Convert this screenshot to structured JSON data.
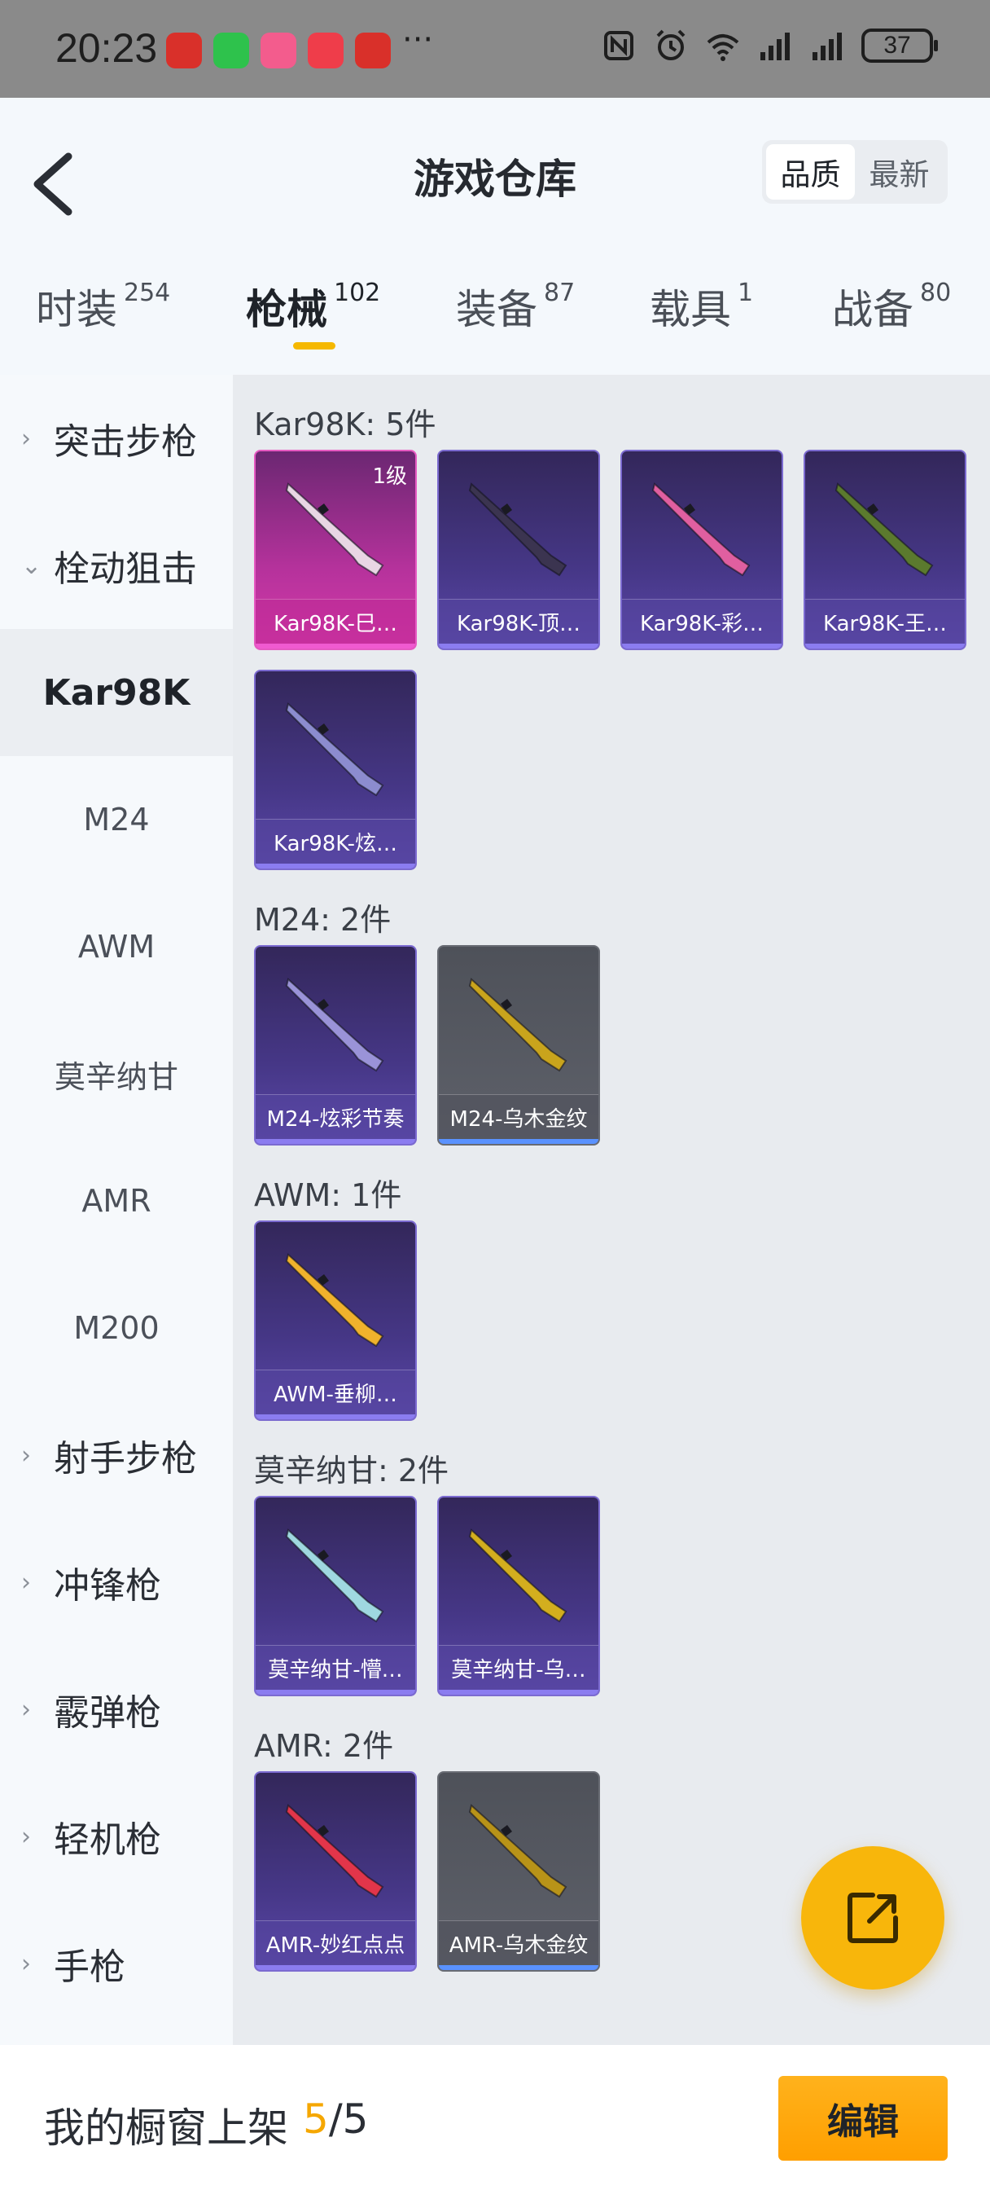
{
  "status_bar": {
    "time": "20:23",
    "apps": [
      {
        "icon": "takeout-app-icon",
        "color": "#d9302a"
      },
      {
        "icon": "wechat-app-icon",
        "color": "#2ec24c"
      },
      {
        "icon": "bilibili-app-icon",
        "color": "#f35c8d"
      },
      {
        "icon": "red-book-app-icon",
        "color": "#ef3d4a"
      },
      {
        "icon": "takeout-app-icon",
        "color": "#d9302a"
      }
    ],
    "more": "···",
    "battery": "37",
    "wifi_badge": "6"
  },
  "header": {
    "title": "游戏仓库",
    "sort_options": [
      "品质",
      "最新"
    ],
    "active_sort": "品质"
  },
  "tabs": [
    {
      "label": "时装",
      "count": "254"
    },
    {
      "label": "枪械",
      "count": "102",
      "active": true
    },
    {
      "label": "装备",
      "count": "87"
    },
    {
      "label": "载具",
      "count": "1"
    },
    {
      "label": "战备",
      "count": "80"
    }
  ],
  "sidebar": [
    {
      "label": "突击步枪",
      "type": "group",
      "expanded": false
    },
    {
      "label": "栓动狙击",
      "type": "group",
      "expanded": true
    },
    {
      "label": "Kar98K",
      "type": "sub",
      "selected": true
    },
    {
      "label": "M24",
      "type": "sub"
    },
    {
      "label": "AWM",
      "type": "sub"
    },
    {
      "label": "莫辛纳甘",
      "type": "sub"
    },
    {
      "label": "AMR",
      "type": "sub"
    },
    {
      "label": "M200",
      "type": "sub"
    },
    {
      "label": "射手步枪",
      "type": "group",
      "expanded": false
    },
    {
      "label": "冲锋枪",
      "type": "group",
      "expanded": false
    },
    {
      "label": "霰弹枪",
      "type": "group",
      "expanded": false
    },
    {
      "label": "轻机枪",
      "type": "group",
      "expanded": false
    },
    {
      "label": "手枪",
      "type": "group",
      "expanded": false
    }
  ],
  "sections": [
    {
      "title": "Kar98K: 5件",
      "items": [
        {
          "name": "Kar98K-巳…",
          "rarity": "pink",
          "level": "1级",
          "gun_color": "#e9d6e4"
        },
        {
          "name": "Kar98K-顶…",
          "rarity": "purple",
          "gun_color": "#3b3450"
        },
        {
          "name": "Kar98K-彩…",
          "rarity": "purple",
          "gun_color": "#e05fa0"
        },
        {
          "name": "Kar98K-王…",
          "rarity": "purple",
          "gun_color": "#5b7a2e"
        },
        {
          "name": "Kar98K-炫…",
          "rarity": "purple",
          "gun_color": "#8c8ccf"
        }
      ]
    },
    {
      "title": "M24: 2件",
      "items": [
        {
          "name": "M24-炫彩节奏",
          "rarity": "purple",
          "gun_color": "#9a93d8"
        },
        {
          "name": "M24-乌木金纹",
          "rarity": "gray",
          "gun_color": "#c9a41c"
        }
      ]
    },
    {
      "title": "AWM: 1件",
      "items": [
        {
          "name": "AWM-垂柳…",
          "rarity": "purple",
          "gun_color": "#f0b22c"
        }
      ]
    },
    {
      "title": "莫辛纳甘: 2件",
      "items": [
        {
          "name": "莫辛纳甘-懵…",
          "rarity": "purple",
          "gun_color": "#9fd8e0"
        },
        {
          "name": "莫辛纳甘-乌…",
          "rarity": "purple",
          "gun_color": "#d3ae1e"
        }
      ]
    },
    {
      "title": "AMR: 2件",
      "items": [
        {
          "name": "AMR-妙红点点",
          "rarity": "purple",
          "gun_color": "#e2354a"
        },
        {
          "name": "AMR-乌木金纹",
          "rarity": "gray",
          "gun_color": "#b89318"
        }
      ]
    }
  ],
  "fab": {
    "icon": "share-icon"
  },
  "footer": {
    "label": "我的橱窗上架",
    "current": "5",
    "separator": "/",
    "total": "5",
    "edit_label": "编辑",
    "accent": "#f5a700"
  }
}
